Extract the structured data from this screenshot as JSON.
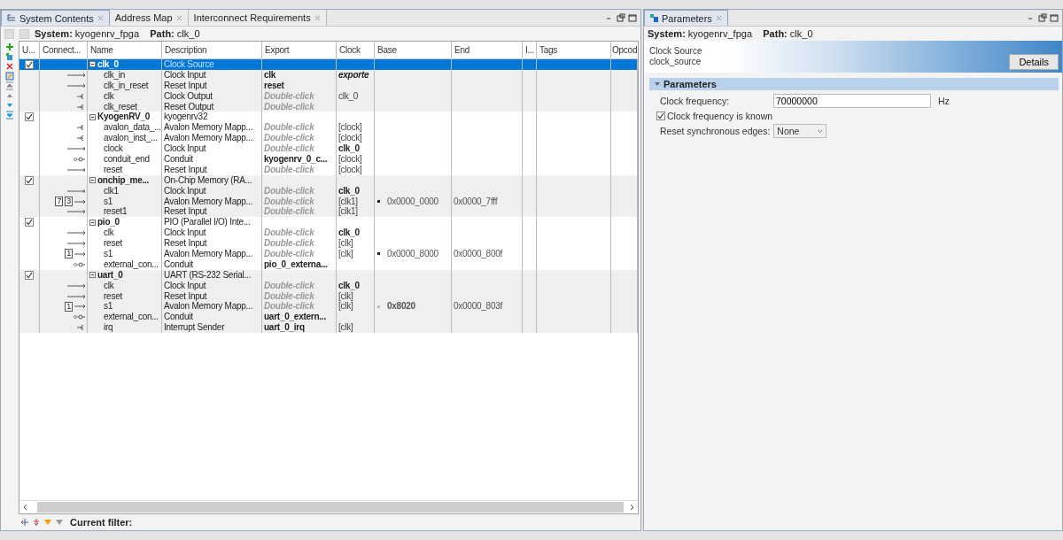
{
  "left_panel": {
    "tabs": [
      {
        "label": "System Contents",
        "selected": true
      },
      {
        "label": "Address Map",
        "selected": false
      },
      {
        "label": "Interconnect Requirements",
        "selected": false
      }
    ],
    "system_label": "System:",
    "system": "kyogenrv_fpga",
    "path_label": "Path:",
    "path": "clk_0",
    "table": {
      "columns": [
        "U...",
        "Connect...",
        "Name",
        "Description",
        "Export",
        "Clock",
        "Base",
        "End",
        "I...",
        "Tags",
        "Opcod"
      ],
      "modules": [
        {
          "enabled": true,
          "selected": true,
          "name": "clk_0",
          "description": "Clock Source",
          "interfaces": [
            {
              "kind": "in",
              "name": "clk_in",
              "description": "Clock Input",
              "export": {
                "text": "clk",
                "kind": "bold"
              },
              "clock": {
                "text": "exporte",
                "kind": "emphasis"
              }
            },
            {
              "kind": "in",
              "name": "clk_in_reset",
              "description": "Reset Input",
              "export": {
                "text": "reset",
                "kind": "bold"
              }
            },
            {
              "kind": "out",
              "name": "clk",
              "description": "Clock Output",
              "export": {
                "text": "Double-click",
                "kind": "hint"
              },
              "clock": {
                "text": "clk_0",
                "kind": "plain"
              }
            },
            {
              "kind": "out",
              "name": "clk_reset",
              "description": "Reset Output",
              "export": {
                "text": "Double-click",
                "kind": "hint"
              }
            }
          ]
        },
        {
          "enabled": true,
          "selected": false,
          "name": "KyogenRV_0",
          "description": "kyogenrv32",
          "interfaces": [
            {
              "kind": "out",
              "name": "avalon_data_...",
              "description": "Avalon Memory Mapp...",
              "export": {
                "text": "Double-click",
                "kind": "hint"
              },
              "clock": {
                "text": "[clock]",
                "kind": "plain"
              }
            },
            {
              "kind": "out",
              "name": "avalon_inst_...",
              "description": "Avalon Memory Mapp...",
              "export": {
                "text": "Double-click",
                "kind": "hint"
              },
              "clock": {
                "text": "[clock]",
                "kind": "plain"
              }
            },
            {
              "kind": "in",
              "name": "clock",
              "description": "Clock Input",
              "export": {
                "text": "Double-click",
                "kind": "hint"
              },
              "clock": {
                "text": "clk_0",
                "kind": "bold"
              }
            },
            {
              "kind": "conduit",
              "name": "conduit_end",
              "description": "Conduit",
              "export": {
                "text": "kyogenrv_0_c...",
                "kind": "bold"
              },
              "clock": {
                "text": "[clock]",
                "kind": "plain"
              }
            },
            {
              "kind": "in",
              "name": "reset",
              "description": "Reset Input",
              "export": {
                "text": "Double-click",
                "kind": "hint"
              },
              "clock": {
                "text": "[clock]",
                "kind": "plain"
              }
            }
          ]
        },
        {
          "enabled": true,
          "selected": false,
          "name": "onchip_me...",
          "description": "On-Chip Memory (RA...",
          "interfaces": [
            {
              "kind": "in",
              "name": "clk1",
              "description": "Clock Input",
              "export": {
                "text": "Double-click",
                "kind": "hint"
              },
              "clock": {
                "text": "clk_0",
                "kind": "bold"
              }
            },
            {
              "kind": "in",
              "name": "s1",
              "description": "Avalon Memory Mapp...",
              "export": {
                "text": "Double-click",
                "kind": "hint"
              },
              "clock": {
                "text": "[clk1]",
                "kind": "plain"
              },
              "base": {
                "text": "0x0000_0000",
                "kind": "plain"
              },
              "end": "0x0000_7fff",
              "badges": [
                "7",
                "3"
              ]
            },
            {
              "kind": "in",
              "name": "reset1",
              "description": "Reset Input",
              "export": {
                "text": "Double-click",
                "kind": "hint"
              },
              "clock": {
                "text": "[clk1]",
                "kind": "plain"
              }
            }
          ]
        },
        {
          "enabled": true,
          "selected": false,
          "name": "pio_0",
          "description": "PIO (Parallel I/O) Inte...",
          "interfaces": [
            {
              "kind": "in",
              "name": "clk",
              "description": "Clock Input",
              "export": {
                "text": "Double-click",
                "kind": "hint"
              },
              "clock": {
                "text": "clk_0",
                "kind": "bold"
              }
            },
            {
              "kind": "in",
              "name": "reset",
              "description": "Reset Input",
              "export": {
                "text": "Double-click",
                "kind": "hint"
              },
              "clock": {
                "text": "[clk]",
                "kind": "plain"
              }
            },
            {
              "kind": "in",
              "name": "s1",
              "description": "Avalon Memory Mapp...",
              "export": {
                "text": "Double-click",
                "kind": "hint"
              },
              "clock": {
                "text": "[clk]",
                "kind": "plain"
              },
              "base": {
                "text": "0x0000_8000",
                "kind": "plain"
              },
              "end": "0x0000_800f",
              "badges": [
                "1"
              ]
            },
            {
              "kind": "conduit",
              "name": "external_con...",
              "description": "Conduit",
              "export": {
                "text": "pio_0_externa...",
                "kind": "bold"
              }
            }
          ]
        },
        {
          "enabled": true,
          "selected": false,
          "name": "uart_0",
          "description": "UART (RS-232 Serial...",
          "interfaces": [
            {
              "kind": "in",
              "name": "clk",
              "description": "Clock Input",
              "export": {
                "text": "Double-click",
                "kind": "hint"
              },
              "clock": {
                "text": "clk_0",
                "kind": "bold"
              }
            },
            {
              "kind": "in",
              "name": "reset",
              "description": "Reset Input",
              "export": {
                "text": "Double-click",
                "kind": "hint"
              },
              "clock": {
                "text": "[clk]",
                "kind": "plain"
              }
            },
            {
              "kind": "in",
              "name": "s1",
              "description": "Avalon Memory Mapp...",
              "export": {
                "text": "Double-click",
                "kind": "hint"
              },
              "clock": {
                "text": "[clk]",
                "kind": "plain"
              },
              "base": {
                "text": "0x8020",
                "kind": "bold"
              },
              "end": "0x0000_803f",
              "badges": [
                "1"
              ]
            },
            {
              "kind": "conduit",
              "name": "external_con...",
              "description": "Conduit",
              "export": {
                "text": "uart_0_extern...",
                "kind": "bold"
              }
            },
            {
              "kind": "out",
              "name": "irq",
              "description": "Interrupt Sender",
              "export": {
                "text": "uart_0_irq",
                "kind": "bold"
              },
              "clock": {
                "text": "[clk]",
                "kind": "plain"
              }
            }
          ]
        }
      ]
    },
    "filter_label": "Current filter:"
  },
  "right_panel": {
    "tab": {
      "label": "Parameters",
      "selected": true
    },
    "system_label": "System:",
    "system": "kyogenrv_fpga",
    "path_label": "Path:",
    "path": "clk_0",
    "component_name": "Clock Source",
    "component_type": "clock_source",
    "details_button": "Details",
    "section": "Parameters",
    "fields": [
      {
        "kind": "text",
        "label": "Clock frequency:",
        "value": "70000000",
        "unit": "Hz"
      },
      {
        "kind": "checkbox",
        "label": "Clock frequency is known",
        "checked": true
      },
      {
        "kind": "select",
        "label": "Reset synchronous edges:",
        "value": "None"
      }
    ]
  }
}
